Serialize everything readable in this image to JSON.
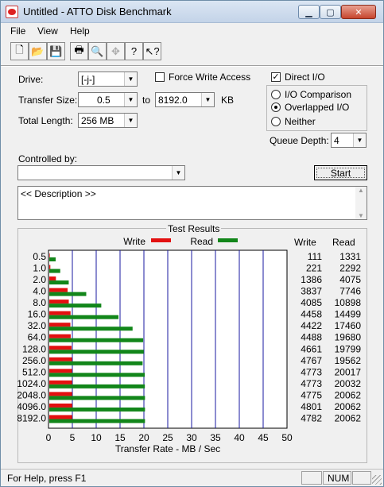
{
  "window": {
    "title": "Untitled - ATTO Disk Benchmark",
    "min_glyph": "▁",
    "max_glyph": "▢",
    "close_glyph": "✕"
  },
  "menu": {
    "file": "File",
    "view": "View",
    "help": "Help"
  },
  "toolbar": {
    "new_glyph": "🗋",
    "open_glyph": "📂",
    "save_glyph": "💾",
    "print_glyph": "🖶",
    "preview_glyph": "🔍",
    "move_glyph": "✥",
    "help_glyph": "?",
    "context_help_glyph": "↖?"
  },
  "form": {
    "drive_label": "Drive:",
    "drive_value": "[-j-]",
    "force_write_label": "Force Write Access",
    "direct_io_label": "Direct I/O",
    "direct_io_checked": "✓",
    "transfer_size_label": "Transfer Size:",
    "transfer_from": "0.5",
    "to_label": "to",
    "transfer_to": "8192.0",
    "kb_label": "KB",
    "total_length_label": "Total Length:",
    "total_length_value": "256 MB",
    "io_comparison_label": "I/O Comparison",
    "overlapped_io_label": "Overlapped I/O",
    "neither_label": "Neither",
    "queue_depth_label": "Queue Depth:",
    "queue_depth_value": "4",
    "controlled_by_label": "Controlled by:",
    "controlled_by_value": "",
    "start_label": "Start",
    "description": "<< Description >>"
  },
  "results": {
    "title": "Test Results",
    "write_legend": "Write",
    "read_legend": "Read",
    "write_col": "Write",
    "read_col": "Read"
  },
  "colors": {
    "write": "#e31010",
    "read": "#12861a",
    "grid": "#1a1aa0"
  },
  "chart_data": {
    "type": "bar",
    "orientation": "horizontal",
    "title": "Test Results",
    "xlabel": "Transfer Rate - MB / Sec",
    "ylabel": "",
    "xlim": [
      0,
      50
    ],
    "xticks": [
      0,
      5,
      10,
      15,
      20,
      25,
      30,
      35,
      40,
      45,
      50
    ],
    "grid": true,
    "legend": "top",
    "categories": [
      "0.5",
      "1.0",
      "2.0",
      "4.0",
      "8.0",
      "16.0",
      "32.0",
      "64.0",
      "128.0",
      "256.0",
      "512.0",
      "1024.0",
      "2048.0",
      "4096.0",
      "8192.0"
    ],
    "series": [
      {
        "name": "Write",
        "values": [
          111,
          221,
          1386,
          3837,
          4085,
          4458,
          4422,
          4488,
          4661,
          4767,
          4773,
          4773,
          4775,
          4801,
          4782
        ]
      },
      {
        "name": "Read",
        "values": [
          1331,
          2292,
          4075,
          7746,
          10898,
          14499,
          17460,
          19680,
          19799,
          19562,
          20017,
          20032,
          20062,
          20062,
          20062
        ]
      }
    ]
  },
  "status": {
    "text": "For Help, press F1",
    "num": "NUM"
  }
}
